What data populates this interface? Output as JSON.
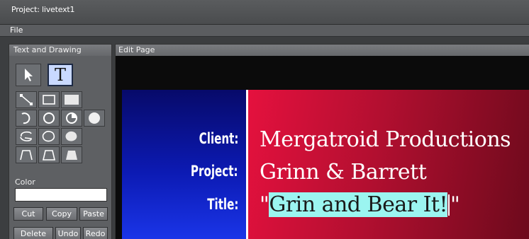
{
  "window": {
    "title": "Project: livetext1"
  },
  "menu": {
    "file": "File"
  },
  "left_panel": {
    "title": "Text and Drawing",
    "tools": [
      "pointer-icon",
      "text-icon",
      "line-icon",
      "rectangle-outline-icon",
      "rectangle-filled-icon",
      "arc-icon",
      "circle-outline-icon",
      "pie-icon",
      "circle-filled-icon",
      "freeform-outline-icon",
      "blob-outline-icon",
      "blob-filled-icon",
      "trapezoid-curve-icon",
      "trapezoid-outline-icon",
      "trapezoid-filled-icon"
    ],
    "text_tool_glyph": "T",
    "color_label": "Color",
    "color_value": "",
    "buttons": {
      "cut": "Cut",
      "copy": "Copy",
      "paste": "Paste",
      "delete": "Delete",
      "undo": "Undo",
      "redo": "Redo"
    }
  },
  "edit_panel": {
    "title": "Edit Page",
    "slide": {
      "client_label": "Client:",
      "client_value": "Mergatroid Productions",
      "project_label": "Project:",
      "project_value": "Grinn & Barrett",
      "title_label": "Title:",
      "title_open_quote": "\"",
      "title_value": "Grin and Bear It!",
      "title_close_quote": "\""
    }
  },
  "colors": {
    "title_highlight": "#9bf5f0",
    "slide_left": "#0c1ab3",
    "slide_right": "#b20f30"
  }
}
